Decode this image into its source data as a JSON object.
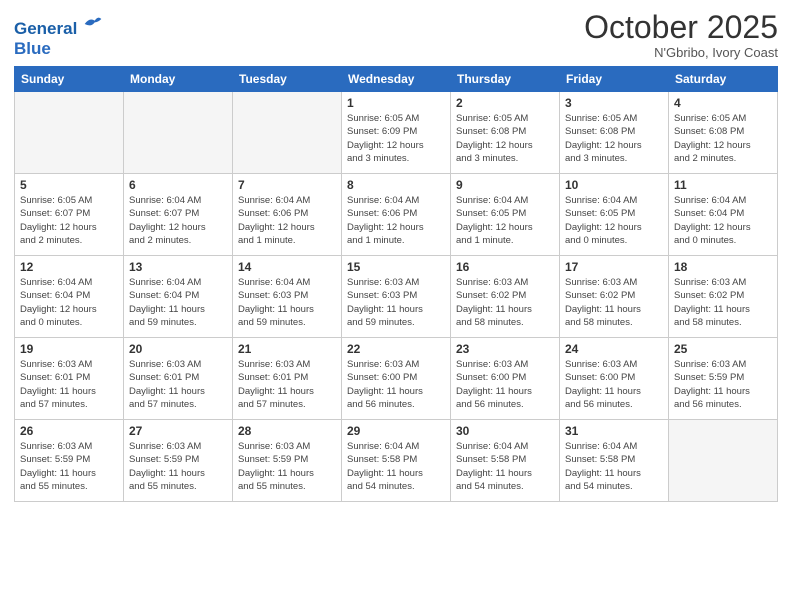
{
  "header": {
    "logo_line1": "General",
    "logo_line2": "Blue",
    "month": "October 2025",
    "location": "N'Gbribo, Ivory Coast"
  },
  "weekdays": [
    "Sunday",
    "Monday",
    "Tuesday",
    "Wednesday",
    "Thursday",
    "Friday",
    "Saturday"
  ],
  "weeks": [
    [
      {
        "day": "",
        "detail": ""
      },
      {
        "day": "",
        "detail": ""
      },
      {
        "day": "",
        "detail": ""
      },
      {
        "day": "1",
        "detail": "Sunrise: 6:05 AM\nSunset: 6:09 PM\nDaylight: 12 hours\nand 3 minutes."
      },
      {
        "day": "2",
        "detail": "Sunrise: 6:05 AM\nSunset: 6:08 PM\nDaylight: 12 hours\nand 3 minutes."
      },
      {
        "day": "3",
        "detail": "Sunrise: 6:05 AM\nSunset: 6:08 PM\nDaylight: 12 hours\nand 3 minutes."
      },
      {
        "day": "4",
        "detail": "Sunrise: 6:05 AM\nSunset: 6:08 PM\nDaylight: 12 hours\nand 2 minutes."
      }
    ],
    [
      {
        "day": "5",
        "detail": "Sunrise: 6:05 AM\nSunset: 6:07 PM\nDaylight: 12 hours\nand 2 minutes."
      },
      {
        "day": "6",
        "detail": "Sunrise: 6:04 AM\nSunset: 6:07 PM\nDaylight: 12 hours\nand 2 minutes."
      },
      {
        "day": "7",
        "detail": "Sunrise: 6:04 AM\nSunset: 6:06 PM\nDaylight: 12 hours\nand 1 minute."
      },
      {
        "day": "8",
        "detail": "Sunrise: 6:04 AM\nSunset: 6:06 PM\nDaylight: 12 hours\nand 1 minute."
      },
      {
        "day": "9",
        "detail": "Sunrise: 6:04 AM\nSunset: 6:05 PM\nDaylight: 12 hours\nand 1 minute."
      },
      {
        "day": "10",
        "detail": "Sunrise: 6:04 AM\nSunset: 6:05 PM\nDaylight: 12 hours\nand 0 minutes."
      },
      {
        "day": "11",
        "detail": "Sunrise: 6:04 AM\nSunset: 6:04 PM\nDaylight: 12 hours\nand 0 minutes."
      }
    ],
    [
      {
        "day": "12",
        "detail": "Sunrise: 6:04 AM\nSunset: 6:04 PM\nDaylight: 12 hours\nand 0 minutes."
      },
      {
        "day": "13",
        "detail": "Sunrise: 6:04 AM\nSunset: 6:04 PM\nDaylight: 11 hours\nand 59 minutes."
      },
      {
        "day": "14",
        "detail": "Sunrise: 6:04 AM\nSunset: 6:03 PM\nDaylight: 11 hours\nand 59 minutes."
      },
      {
        "day": "15",
        "detail": "Sunrise: 6:03 AM\nSunset: 6:03 PM\nDaylight: 11 hours\nand 59 minutes."
      },
      {
        "day": "16",
        "detail": "Sunrise: 6:03 AM\nSunset: 6:02 PM\nDaylight: 11 hours\nand 58 minutes."
      },
      {
        "day": "17",
        "detail": "Sunrise: 6:03 AM\nSunset: 6:02 PM\nDaylight: 11 hours\nand 58 minutes."
      },
      {
        "day": "18",
        "detail": "Sunrise: 6:03 AM\nSunset: 6:02 PM\nDaylight: 11 hours\nand 58 minutes."
      }
    ],
    [
      {
        "day": "19",
        "detail": "Sunrise: 6:03 AM\nSunset: 6:01 PM\nDaylight: 11 hours\nand 57 minutes."
      },
      {
        "day": "20",
        "detail": "Sunrise: 6:03 AM\nSunset: 6:01 PM\nDaylight: 11 hours\nand 57 minutes."
      },
      {
        "day": "21",
        "detail": "Sunrise: 6:03 AM\nSunset: 6:01 PM\nDaylight: 11 hours\nand 57 minutes."
      },
      {
        "day": "22",
        "detail": "Sunrise: 6:03 AM\nSunset: 6:00 PM\nDaylight: 11 hours\nand 56 minutes."
      },
      {
        "day": "23",
        "detail": "Sunrise: 6:03 AM\nSunset: 6:00 PM\nDaylight: 11 hours\nand 56 minutes."
      },
      {
        "day": "24",
        "detail": "Sunrise: 6:03 AM\nSunset: 6:00 PM\nDaylight: 11 hours\nand 56 minutes."
      },
      {
        "day": "25",
        "detail": "Sunrise: 6:03 AM\nSunset: 5:59 PM\nDaylight: 11 hours\nand 56 minutes."
      }
    ],
    [
      {
        "day": "26",
        "detail": "Sunrise: 6:03 AM\nSunset: 5:59 PM\nDaylight: 11 hours\nand 55 minutes."
      },
      {
        "day": "27",
        "detail": "Sunrise: 6:03 AM\nSunset: 5:59 PM\nDaylight: 11 hours\nand 55 minutes."
      },
      {
        "day": "28",
        "detail": "Sunrise: 6:03 AM\nSunset: 5:59 PM\nDaylight: 11 hours\nand 55 minutes."
      },
      {
        "day": "29",
        "detail": "Sunrise: 6:04 AM\nSunset: 5:58 PM\nDaylight: 11 hours\nand 54 minutes."
      },
      {
        "day": "30",
        "detail": "Sunrise: 6:04 AM\nSunset: 5:58 PM\nDaylight: 11 hours\nand 54 minutes."
      },
      {
        "day": "31",
        "detail": "Sunrise: 6:04 AM\nSunset: 5:58 PM\nDaylight: 11 hours\nand 54 minutes."
      },
      {
        "day": "",
        "detail": ""
      }
    ]
  ]
}
